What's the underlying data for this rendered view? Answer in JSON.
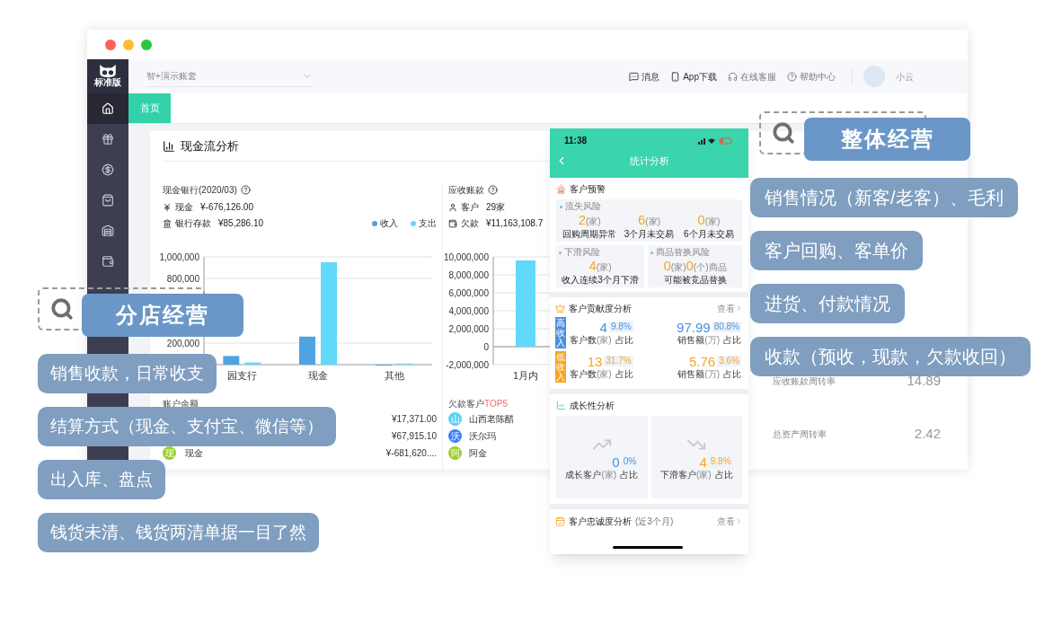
{
  "window": {
    "logo_text": "标准版",
    "account": "智+演示账套",
    "header_links": [
      {
        "label": "消息"
      },
      {
        "label": "App下载"
      },
      {
        "label": "在线客服"
      },
      {
        "label": "帮助中心"
      }
    ],
    "user": "小云",
    "sidebar": [
      {
        "selected": true
      },
      {
        "selected": false
      },
      {
        "selected": false
      },
      {
        "selected": false
      },
      {
        "selected": false
      },
      {
        "selected": false
      }
    ],
    "tabs": [
      {
        "label": "首页",
        "selected": true
      }
    ]
  },
  "cash_flow": {
    "title": "现金流分析",
    "bank_title": "现金银行(2020/03)",
    "cash_label": "现金",
    "cash_value": "¥-676,126.00",
    "deposit_label": "银行存款",
    "deposit_value": "¥85,286.10",
    "chart_data": {
      "type": "bar",
      "categories": [
        "园支行",
        "现金",
        "其他"
      ],
      "series": [
        {
          "name": "收入",
          "color": "#4fa3e0",
          "values": [
            80000,
            260000,
            0
          ]
        },
        {
          "name": "支出",
          "color": "#62d9fa",
          "values": [
            20000,
            950000,
            10000
          ]
        }
      ],
      "grid": true,
      "ylim": [
        0,
        1000000
      ],
      "yticks": [
        {
          "value": 200000,
          "label": "200,000"
        },
        {
          "value": 800000,
          "label": "800,000"
        },
        {
          "value": 1000000,
          "label": "1,000,000"
        }
      ]
    },
    "balances_title": "账户余额",
    "accounts": [
      {
        "value": "¥17,371.00"
      },
      {
        "value": "¥67,915.10"
      },
      {
        "avatar": "现",
        "color": "#9acd32",
        "name": "现金",
        "value": "¥-681,620...."
      }
    ]
  },
  "receivables": {
    "title": "应收账款",
    "customers_label": "客户",
    "customers_value": "29家",
    "debt_label": "欠款",
    "debt_value": "¥11,163,108.7",
    "chart_data": {
      "type": "bar",
      "categories": [
        "1月内"
      ],
      "series": [
        {
          "color": "#62d9fa",
          "values": [
            9600000
          ]
        }
      ],
      "grid": true,
      "ylim": [
        -2000000,
        10000000
      ],
      "yticks": [
        {
          "value": -2000000,
          "label": "-2,000,000"
        },
        {
          "value": 0,
          "label": "0"
        },
        {
          "value": 2000000,
          "label": "2,000,000"
        },
        {
          "value": 4000000,
          "label": "4,000,000"
        },
        {
          "value": 6000000,
          "label": "6,000,000"
        },
        {
          "value": 8000000,
          "label": "8,000,000"
        },
        {
          "value": 10000000,
          "label": "10,000,000"
        }
      ]
    },
    "top_title": "欠款客户",
    "top_highlight": "TOP5",
    "top": [
      {
        "avatar": "山",
        "color": "#5ad0f5",
        "name": "山西老陈醋"
      },
      {
        "avatar": "沃",
        "color": "#3b82f6",
        "name": "沃尔玛"
      },
      {
        "avatar": "阿",
        "color": "#9acd32",
        "name": "阿金"
      }
    ]
  },
  "ratios": [
    {
      "label": "应收账款周转率",
      "value": "14.89"
    },
    {
      "label": "总资产周转率",
      "value": "2.42"
    }
  ],
  "phone": {
    "time": "11:38",
    "title": "统计分析",
    "warning": {
      "title": "客户预警",
      "loss": {
        "label": "流失风险",
        "stats": [
          {
            "value": "2",
            "unit": "(家)",
            "label": "回购周期异常"
          },
          {
            "value": "6",
            "unit": "(家)",
            "label": "3个月未交易"
          },
          {
            "value": "0",
            "unit": "(家)",
            "label": "6个月未交易"
          }
        ]
      },
      "decline": {
        "label": "下滑风险",
        "value": "4",
        "unit": "(家)",
        "text": "收入连续3个月下滑"
      },
      "replace": {
        "label": "商品替换风险",
        "value": "0",
        "unit": "(家)",
        "value2": "0",
        "unit2": "(个)商品",
        "text": "可能被竞品替换"
      }
    },
    "contribution": {
      "title": "客户贡献度分析",
      "link": "查看",
      "rows": [
        {
          "tag": "高收入",
          "color": "#4a90e2",
          "stats": [
            {
              "value": "4",
              "pct": "9.8%",
              "label": "客户数",
              "unit": "(家)",
              "suffix": "占比"
            },
            {
              "value": "97.99",
              "pct": "80.8%",
              "label": "销售额",
              "unit": "(万)",
              "suffix": "占比"
            }
          ]
        },
        {
          "tag": "低收入",
          "color": "#f5a623",
          "stats": [
            {
              "value": "13",
              "pct": "31.7%",
              "label": "客户数",
              "unit": "(家)",
              "suffix": "占比"
            },
            {
              "value": "5.76",
              "pct": "3.6%",
              "label": "销售额",
              "unit": "(万)",
              "suffix": "占比"
            }
          ]
        }
      ]
    },
    "growth": {
      "title": "成长性分析",
      "cards": [
        {
          "kind": "up",
          "color": "#4a90e2",
          "value": "0",
          "pct": "0%",
          "label": "成长客户",
          "unit": "(家)",
          "suffix": "占比"
        },
        {
          "kind": "down",
          "color": "#f5a623",
          "value": "4",
          "pct": "9.8%",
          "label": "下滑客户",
          "unit": "(家)",
          "suffix": "占比"
        }
      ]
    },
    "loyalty": {
      "title": "客户忠诚度分析",
      "note": "(近3个月)",
      "link": "查看"
    }
  },
  "headings": [
    {
      "text": "整体经营"
    },
    {
      "text": "分店经营"
    }
  ],
  "notes_right": [
    {
      "text": "销售情况（新客/老客）、毛利"
    },
    {
      "text": "客户回购、客单价"
    },
    {
      "text": "进货、付款情况"
    },
    {
      "text": "收款（预收，现款，欠款收回）"
    }
  ],
  "notes_left": [
    {
      "text": "销售收款，日常收支"
    },
    {
      "text": "结算方式（现金、支付宝、微信等）"
    },
    {
      "text": "出入库、盘点"
    },
    {
      "text": "钱货未清、钱货两清单据一目了然"
    }
  ]
}
